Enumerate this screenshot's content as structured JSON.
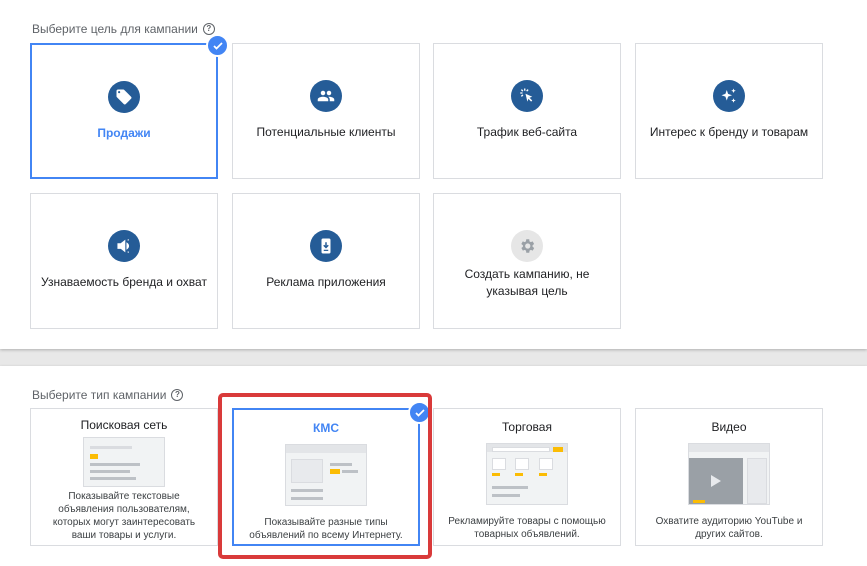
{
  "goals_section": {
    "label": "Выберите цель для кампании",
    "help": "?",
    "cards": [
      {
        "label": "Продажи",
        "icon": "tag-icon"
      },
      {
        "label": "Потенциальные клиенты",
        "icon": "people-icon"
      },
      {
        "label": "Трафик веб-сайта",
        "icon": "cursor-click-icon"
      },
      {
        "label": "Интерес к бренду и товарам",
        "icon": "sparkle-icon"
      },
      {
        "label": "Узнаваемость бренда и охват",
        "icon": "speaker-icon"
      },
      {
        "label": "Реклама приложения",
        "icon": "phone-download-icon"
      },
      {
        "label": "Создать кампанию, не указывая цель",
        "icon": "gear-icon"
      }
    ]
  },
  "types_section": {
    "label": "Выберите тип кампании",
    "help": "?",
    "cards": [
      {
        "title": "Поисковая сеть",
        "desc": "Показывайте текстовые объявления пользователям, которых могут заинтересовать ваши товары и услуги."
      },
      {
        "title": "КМС",
        "desc": "Показывайте разные типы объявлений по всему Интернету."
      },
      {
        "title": "Торговая",
        "desc": "Рекламируйте товары с помощью товарных объявлений."
      },
      {
        "title": "Видео",
        "desc": "Охватите аудиторию YouTube и других сайтов."
      }
    ]
  },
  "colors": {
    "accent": "#4285f4",
    "icon_bg": "#255c97",
    "highlight": "#d93a3a",
    "ad_yellow": "#fbbc04"
  }
}
